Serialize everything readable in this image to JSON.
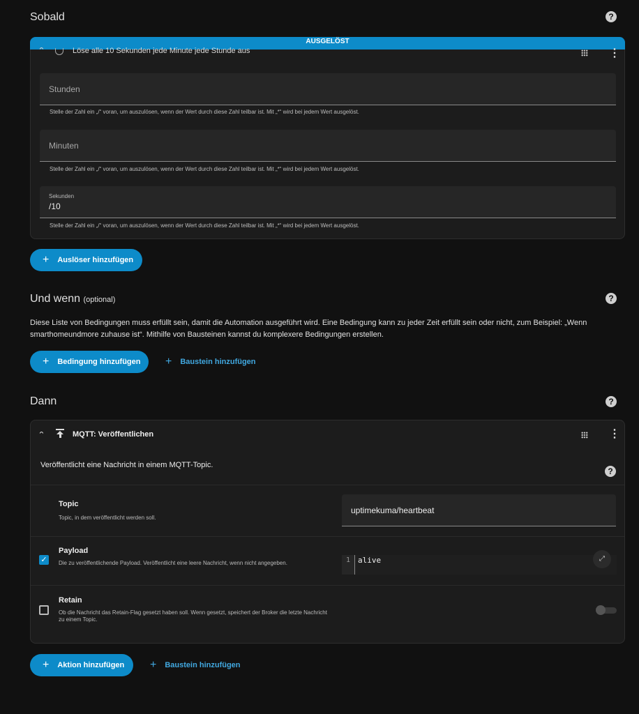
{
  "sobald": {
    "title": "Sobald",
    "trigger": {
      "badge": "AUSGELÖST",
      "header": "Löse alle 10 Sekunden jede Minute jede Stunde aus",
      "fields": [
        {
          "label": "Stunden",
          "value": ""
        },
        {
          "label": "Minuten",
          "value": ""
        },
        {
          "label": "Sekunden",
          "value": "/10"
        }
      ],
      "hint": "Stelle der Zahl ein „/“ voran, um auszulösen, wenn der Wert durch diese Zahl teilbar ist. Mit „*“ wird bei jedem Wert ausgelöst."
    },
    "add_button": "Auslöser hinzufügen"
  },
  "und_wenn": {
    "title": "Und wenn",
    "optional": "(optional)",
    "description": "Diese Liste von Bedingungen muss erfüllt sein, damit die Automation ausgeführt wird. Eine Bedingung kann zu jeder Zeit erfüllt sein oder nicht, zum Beispiel: „Wenn smarthomeundmore zuhause ist“. Mithilfe von Bausteinen kannst du komplexere Bedingungen erstellen.",
    "add_button": "Bedingung hinzufügen",
    "building_block": "Baustein hinzufügen"
  },
  "dann": {
    "title": "Dann",
    "action": {
      "header": "MQTT: Veröffentlichen",
      "description": "Veröffentlicht eine Nachricht in einem MQTT-Topic.",
      "topic": {
        "label": "Topic",
        "hint": "Topic, in dem veröffentlicht werden soll.",
        "value": "uptimekuma/heartbeat"
      },
      "payload": {
        "label": "Payload",
        "hint": "Die zu veröffentlichende Payload. Veröffentlicht eine leere Nachricht, wenn nicht angegeben.",
        "line_number": "1",
        "value": "alive",
        "checked": true
      },
      "retain": {
        "label": "Retain",
        "hint": "Ob die Nachricht das Retain-Flag gesetzt haben soll. Wenn gesetzt, speichert der Broker die letzte Nachricht zu einem Topic.",
        "checked": false,
        "enabled": false
      }
    },
    "add_button": "Aktion hinzufügen",
    "building_block": "Baustein hinzufügen"
  },
  "colors": {
    "accent": "#0d8bc9",
    "background": "#111111",
    "card": "#1c1c1c"
  },
  "help_icon": "?"
}
